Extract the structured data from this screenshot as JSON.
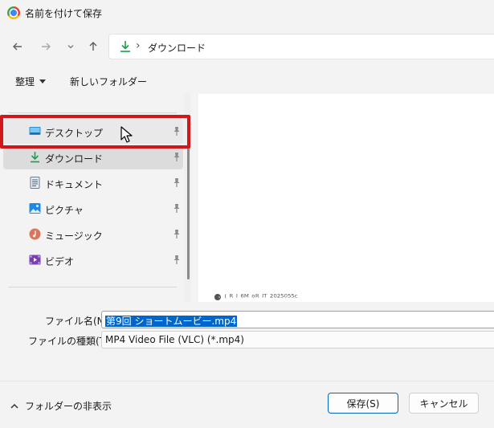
{
  "window": {
    "title": "名前を付けて保存"
  },
  "address_bar": {
    "path_separator": "›",
    "current_folder": "ダウンロード"
  },
  "toolbar": {
    "organize_label": "整理",
    "new_folder_label": "新しいフォルダー"
  },
  "sidebar": {
    "items": [
      {
        "label": "デスクトップ",
        "icon": "desktop-icon"
      },
      {
        "label": "ダウンロード",
        "icon": "download-icon"
      },
      {
        "label": "ドキュメント",
        "icon": "documents-icon"
      },
      {
        "label": "ピクチャ",
        "icon": "pictures-icon"
      },
      {
        "label": "ミュージック",
        "icon": "music-icon"
      },
      {
        "label": "ビデオ",
        "icon": "videos-icon"
      }
    ]
  },
  "content": {
    "clipped_text": "⚈ ⁽ ᴿ ᴵ ⁶ᴹ ᵒᴿ ᴵᵀ ²⁰²⁵⁰⁵⁵ᶜ"
  },
  "form": {
    "filename_label": "ファイル名(N):",
    "filename_value": "第9回 ショートムービー.mp4",
    "filetype_label": "ファイルの種類(T):",
    "filetype_value": "MP4 Video File (VLC) (*.mp4)"
  },
  "footer": {
    "hide_folders_label": "フォルダーの非表示",
    "save_label": "保存(S)",
    "cancel_label": "キャンセル"
  },
  "colors": {
    "accent": "#0067c0",
    "highlight": "#d2161a",
    "download_green": "#1a9f53"
  }
}
